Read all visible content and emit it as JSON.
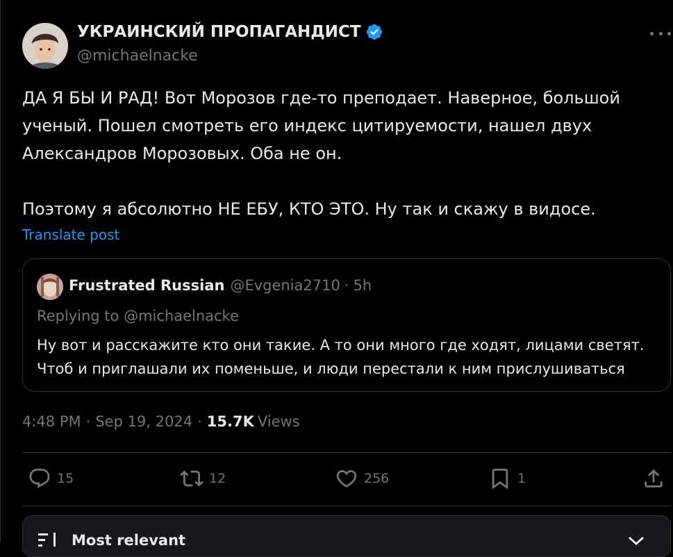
{
  "author": {
    "display_name": "УКРАИНСКИЙ ПРОПАГАНДИСТ",
    "handle": "@michaelnacke",
    "verified": true
  },
  "post": {
    "text": "ДА Я БЫ И РАД! Вот Морозов где-то преподает. Наверное, большой\nученый. Пошел смотреть его индекс цитируемости, нашел двух\nАлександров Морозовых. Оба не он.\n\nПоэтому я абсолютно НЕ ЕБУ, КТО ЭТО. Ну так и скажу в видосе.",
    "translate_label": "Translate post"
  },
  "quote": {
    "name": "Frustrated Russian",
    "handle": "@Evgenia2710",
    "dot": "·",
    "time": "5h",
    "replying_to": "Replying to @michaelnacke",
    "text": "Ну вот и расскажите кто они такие. А то они много где ходят, лицами светят.\nЧтоб и приглашали их поменьше, и люди перестали к ним прислушиваться"
  },
  "meta": {
    "time": "4:48 PM",
    "sep1": "·",
    "date": "Sep 19, 2024",
    "sep2": "·",
    "views_count": "15.7K",
    "views_label": "Views"
  },
  "actions": {
    "replies": "15",
    "reposts": "12",
    "likes": "256",
    "bookmarks": "1"
  },
  "sort": {
    "label": "Most relevant"
  },
  "colors": {
    "background": "#000000",
    "text_primary": "#e7e9ea",
    "text_secondary": "#71767b",
    "accent": "#1d9bf0",
    "border": "#2f3336"
  },
  "icons": [
    "more-icon",
    "verified-icon",
    "reply-icon",
    "repost-icon",
    "like-icon",
    "bookmark-icon",
    "share-icon",
    "sort-icon",
    "chevron-down-icon"
  ]
}
